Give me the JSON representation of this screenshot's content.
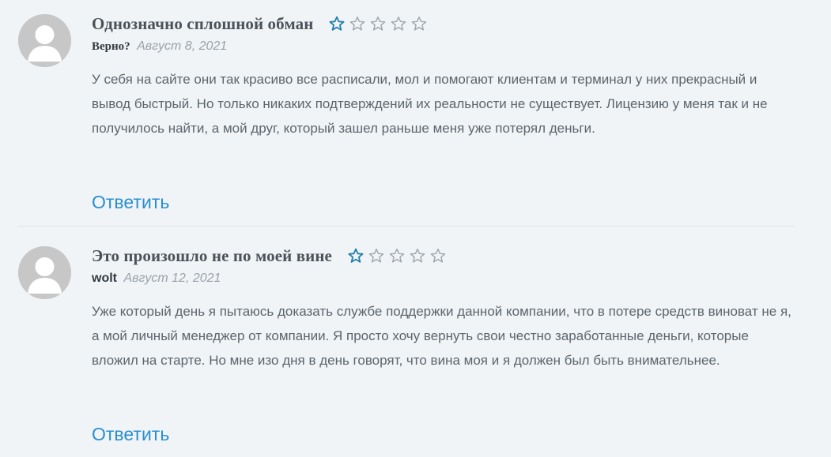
{
  "colors": {
    "background": "#f0f4f7",
    "star_filled_outline": "#1f7fa8",
    "star_empty_outline": "#9ea6ad",
    "reply_link": "#2a8fd1"
  },
  "reviews": [
    {
      "title": "Однозначно сплошной обман",
      "author": "Верно?",
      "date": "Август 8, 2021",
      "rating": 1,
      "max_rating": 5,
      "text": "У себя на сайте они так красиво все расписали, мол и помогают клиентам и терминал у них прекрасный и вывод быстрый. Но только никаких подтверждений их реальности не существует. Лицензию у меня так и не получилось найти, а мой друг, который зашел раньше меня уже потерял деньги.",
      "reply_label": "Ответить"
    },
    {
      "title": "Это произошло не по моей вине",
      "author": "wolt",
      "date": "Август 12, 2021",
      "rating": 1,
      "max_rating": 5,
      "text": "Уже который день я пытаюсь доказать службе поддержки данной компании, что в потере средств виноват не я, а мой личный менеджер от компании. Я просто хочу вернуть свои честно заработанные деньги, которые вложил на старте. Но мне изо дня в день говорят, что вина моя и я должен был быть внимательнее.",
      "reply_label": "Ответить"
    }
  ]
}
